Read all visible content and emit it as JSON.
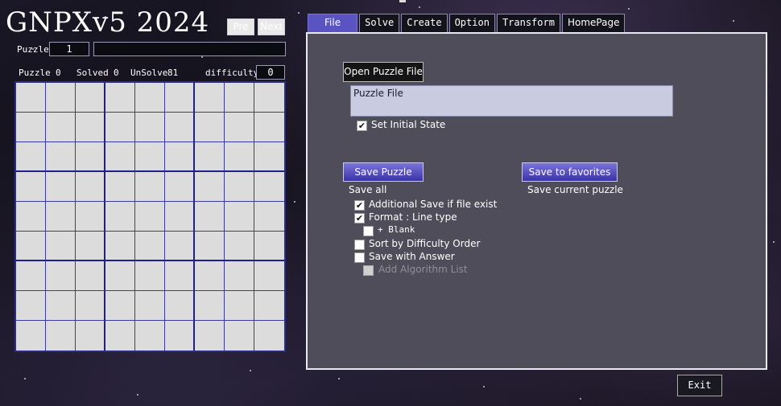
{
  "app": {
    "title": "GNPXv5 2024"
  },
  "nav": {
    "pre_label": "Pre",
    "next_label": "Next"
  },
  "puzzle_header": {
    "label": "Puzzle",
    "number": "1",
    "name": ""
  },
  "stats": {
    "puzzle_label": "Puzzle",
    "puzzle_count": "0",
    "solved_label": "Solved",
    "solved_count": "0",
    "unsolve_label": "UnSolve",
    "unsolve_count": "81",
    "difficulty_label": "difficulty",
    "difficulty_value": "0"
  },
  "tabs": [
    {
      "label": "File"
    },
    {
      "label": "Solve"
    },
    {
      "label": "Create"
    },
    {
      "label": "Option"
    },
    {
      "label": "Transform"
    },
    {
      "label": "HomePage"
    }
  ],
  "file_panel": {
    "open_button": "Open Puzzle File",
    "puzzle_file_text": "Puzzle File",
    "set_initial_state": {
      "label": "Set Initial State",
      "checked": true
    },
    "save_puzzle_button": "Save Puzzle",
    "save_all_label": "Save all",
    "save_favorites_button": "Save to favorites",
    "save_current_label": "Save current puzzle",
    "options": [
      {
        "label": "Additional Save if file exist",
        "checked": true
      },
      {
        "label": "Format : Line type",
        "checked": true
      },
      {
        "label": "+ Blank",
        "checked": false
      },
      {
        "label": "Sort by Difficulty Order",
        "checked": false
      },
      {
        "label": "Save with Answer",
        "checked": false
      },
      {
        "label": "Add Algorithm List",
        "checked": false,
        "disabled": true
      }
    ]
  },
  "footer": {
    "exit_label": "Exit"
  }
}
